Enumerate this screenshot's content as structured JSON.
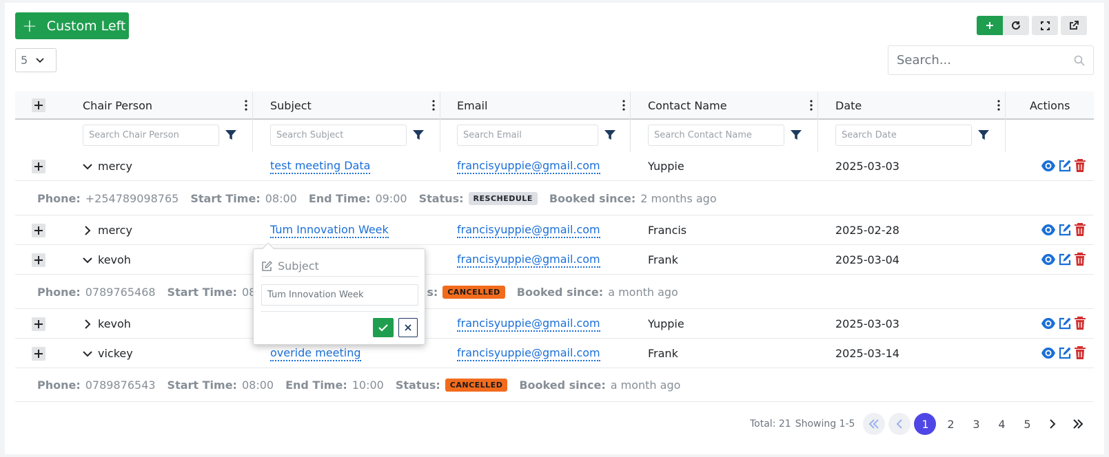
{
  "toolbar": {
    "custom_left_label": "Custom Left",
    "page_size": "5",
    "search_placeholder": "Search...",
    "icons": [
      "plus-icon",
      "refresh-icon",
      "fullscreen-icon",
      "external-link-icon"
    ]
  },
  "table": {
    "columns": [
      "Chair Person",
      "Subject",
      "Email",
      "Contact Name",
      "Date",
      "Actions"
    ],
    "filters": [
      "Search Chair Person",
      "Search Subject",
      "Search Email",
      "Search Contact Name",
      "Search Date"
    ],
    "rows": [
      {
        "chair": "mercy",
        "subject": "test meeting Data",
        "email": "francisyuppie@gmail.com",
        "contact": "Yuppie",
        "date": "2025-03-03",
        "expanded": true
      },
      {
        "chair": "mercy",
        "subject": "Tum Innovation Week",
        "email": "francisyuppie@gmail.com",
        "contact": "Francis",
        "date": "2025-02-28",
        "expanded": false
      },
      {
        "chair": "kevoh",
        "subject": "",
        "email": "francisyuppie@gmail.com",
        "contact": "Frank",
        "date": "2025-03-04",
        "expanded": true
      },
      {
        "chair": "kevoh",
        "subject": "",
        "email": "francisyuppie@gmail.com",
        "contact": "Yuppie",
        "date": "2025-03-03",
        "expanded": false
      },
      {
        "chair": "vickey",
        "subject": "overide meeting",
        "email": "francisyuppie@gmail.com",
        "contact": "Frank",
        "date": "2025-03-14",
        "expanded": true
      }
    ],
    "details": [
      {
        "phone_label": "Phone:",
        "phone": "+254789098765",
        "start_label": "Start Time:",
        "start": "08:00",
        "end_label": "End Time:",
        "end": "09:00",
        "status_label": "Status:",
        "status": "RESCHEDULE",
        "booked_label": "Booked since:",
        "booked": "2 months ago",
        "status_color": "#dcdfe3"
      },
      {
        "phone_label": "Phone:",
        "phone": "0789765468",
        "start_label": "Start Time:",
        "start": "08",
        "status_label": "s:",
        "status": "CANCELLED",
        "booked_label": "Booked since:",
        "booked": "a month ago",
        "status_color": "#f26b1d"
      },
      {
        "phone_label": "Phone:",
        "phone": "0789876543",
        "start_label": "Start Time:",
        "start": "08:00",
        "end_label": "End Time:",
        "end": "10:00",
        "status_label": "Status:",
        "status": "CANCELLED",
        "booked_label": "Booked since:",
        "booked": "a month ago",
        "status_color": "#f26b1d"
      }
    ]
  },
  "popover": {
    "title": "Subject",
    "input_value": "Tum Innovation Week"
  },
  "pagination": {
    "total_text": "Total: 21",
    "showing_text": "Showing 1-5",
    "pages": [
      "1",
      "2",
      "3",
      "4",
      "5"
    ],
    "current": "1"
  },
  "colors": {
    "primary_green": "#1f9e4f",
    "link_blue": "#1a6fd8",
    "delete_red": "#d32f2f",
    "active_page": "#4f46e5",
    "cancelled_orange": "#f26b1d"
  }
}
